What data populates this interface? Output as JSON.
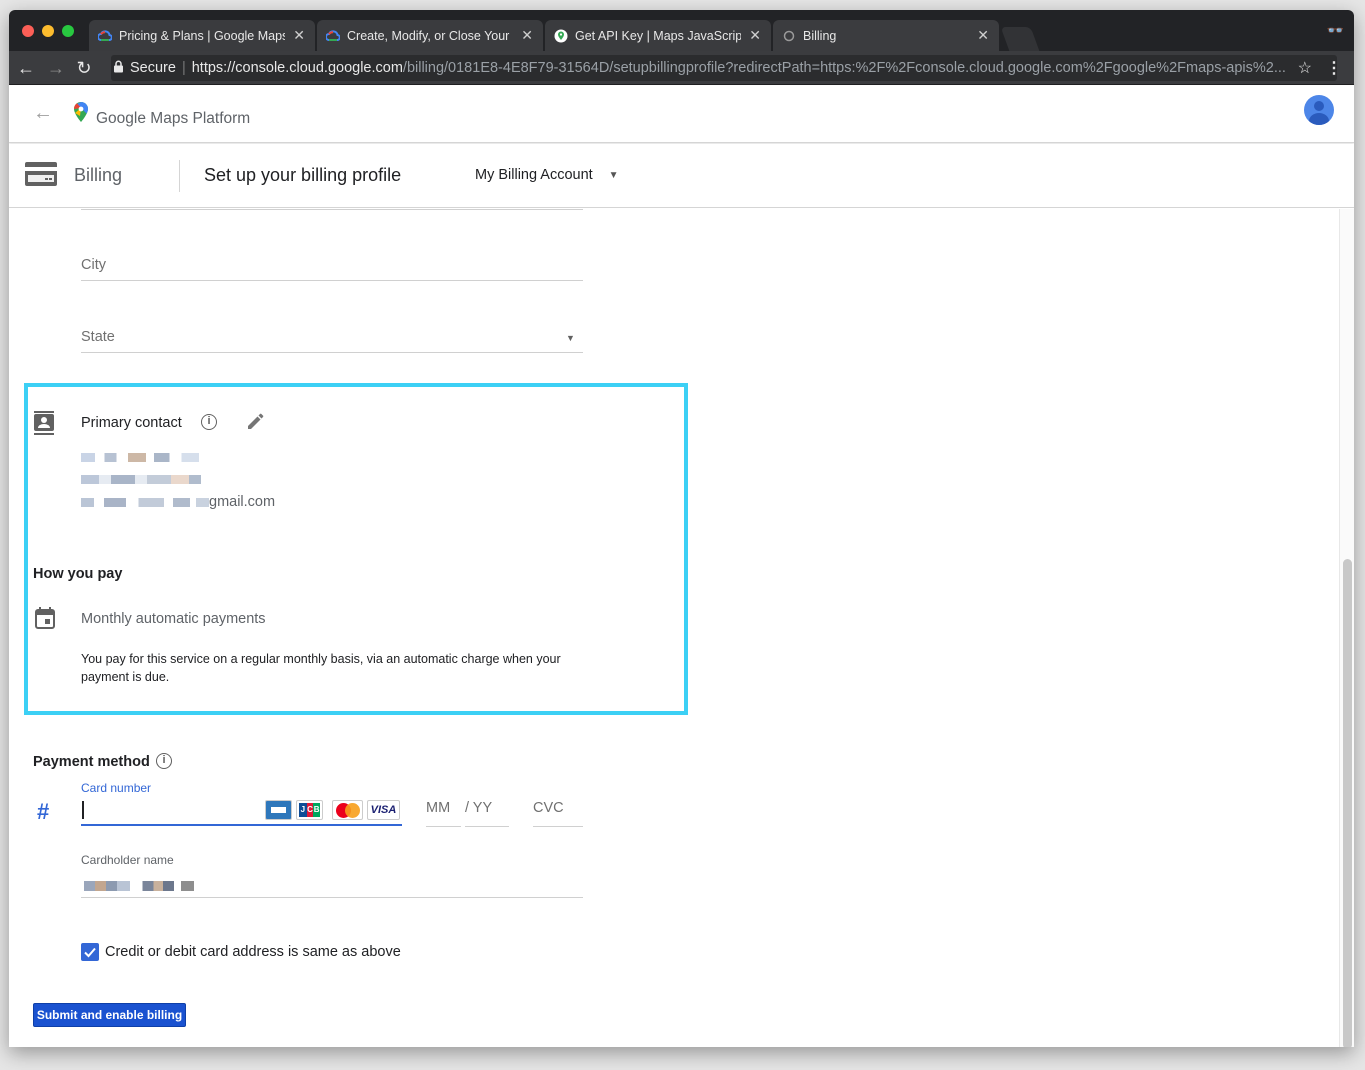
{
  "browser": {
    "tabs": [
      {
        "title": "Pricing & Plans | Google Maps",
        "icon": "google-cloud-icon"
      },
      {
        "title": "Create, Modify, or Close Your B",
        "icon": "google-cloud-icon"
      },
      {
        "title": "Get API Key  |  Maps JavaScrip",
        "icon": "google-maps-icon"
      },
      {
        "title": "Billing",
        "icon": "loading-icon"
      }
    ],
    "secure_label": "Secure",
    "url_host": "https://console.cloud.google.com",
    "url_path": "/billing/0181E8-4E8F79-31564D/setupbillingprofile?redirectPath=https:%2F%2Fconsole.cloud.google.com%2Fgoogle%2Fmaps-apis%2..."
  },
  "app": {
    "title_google": "Google",
    "title_product": "Maps Platform"
  },
  "subheader": {
    "section": "Billing",
    "page_title": "Set up your billing profile",
    "account_selector": "My Billing Account"
  },
  "form": {
    "city_label": "City",
    "state_label": "State",
    "primary_contact": {
      "title": "Primary contact",
      "email_suffix": "gmail.com"
    },
    "how_you_pay": {
      "heading": "How you pay",
      "option": "Monthly automatic payments",
      "description": "You pay for this service on a regular monthly basis, via an automatic charge when your payment is due."
    },
    "payment_method": {
      "heading": "Payment method",
      "card_number_label": "Card number",
      "mm_placeholder": "MM",
      "yy_placeholder": "/ YY",
      "cvc_placeholder": "CVC",
      "cardholder_label": "Cardholder name",
      "same_address_label": "Credit or debit card address is same as above",
      "same_address_checked": true
    },
    "submit_label": "Submit and enable billing"
  },
  "colors": {
    "highlight": "#3cd0f5",
    "primary_blue": "#1a52d0",
    "focus_blue": "#3367d6"
  }
}
